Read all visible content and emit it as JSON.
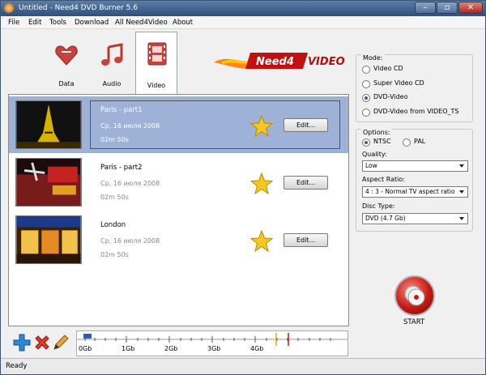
{
  "window": {
    "title": "Untitled - Need4 DVD Burner 5.6"
  },
  "menu": [
    "File",
    "Edit",
    "Tools",
    "Download",
    "All Need4Video",
    "About"
  ],
  "tabs": [
    {
      "label": "Data",
      "icon": "data-heart-icon"
    },
    {
      "label": "Audio",
      "icon": "music-note-icon"
    },
    {
      "label": "Video",
      "icon": "film-icon",
      "active": true
    }
  ],
  "logo_text": "Need4 VIDEO",
  "videos": [
    {
      "title": "Paris - part1",
      "date": "Ср, 16 июля 2008",
      "duration": "02m 50s",
      "edit_label": "Edit...",
      "selected": true
    },
    {
      "title": "Paris - part2",
      "date": "Ср, 16 июля 2008",
      "duration": "02m 50s",
      "edit_label": "Edit..."
    },
    {
      "title": "London",
      "date": "Ср, 16 июля 2008",
      "duration": "02m 50s",
      "edit_label": "Edit..."
    }
  ],
  "timeline": {
    "ticks": [
      "0Gb",
      "1Gb",
      "2Gb",
      "3Gb",
      "4Gb"
    ]
  },
  "mode": {
    "label": "Mode:",
    "options": [
      "Video CD",
      "Super Video CD",
      "DVD-Video",
      "DVD-Video from VIDEO_TS"
    ],
    "selected": "DVD-Video"
  },
  "options": {
    "label": "Options:",
    "ntsc_label": "NTSC",
    "pal_label": "PAL",
    "quality_label": "Quality:",
    "quality_value": "Low",
    "aspect_label": "Aspect Ratio:",
    "aspect_value": "4 : 3 - Normal TV aspect ratio",
    "disc_label": "Disc Type:",
    "disc_value": "DVD (4.7 Gb)"
  },
  "start_label": "START",
  "status": "Ready",
  "colors": {
    "selection": "#9eb1d6",
    "accent_red": "#c21a12",
    "star": "#f4c81e"
  }
}
